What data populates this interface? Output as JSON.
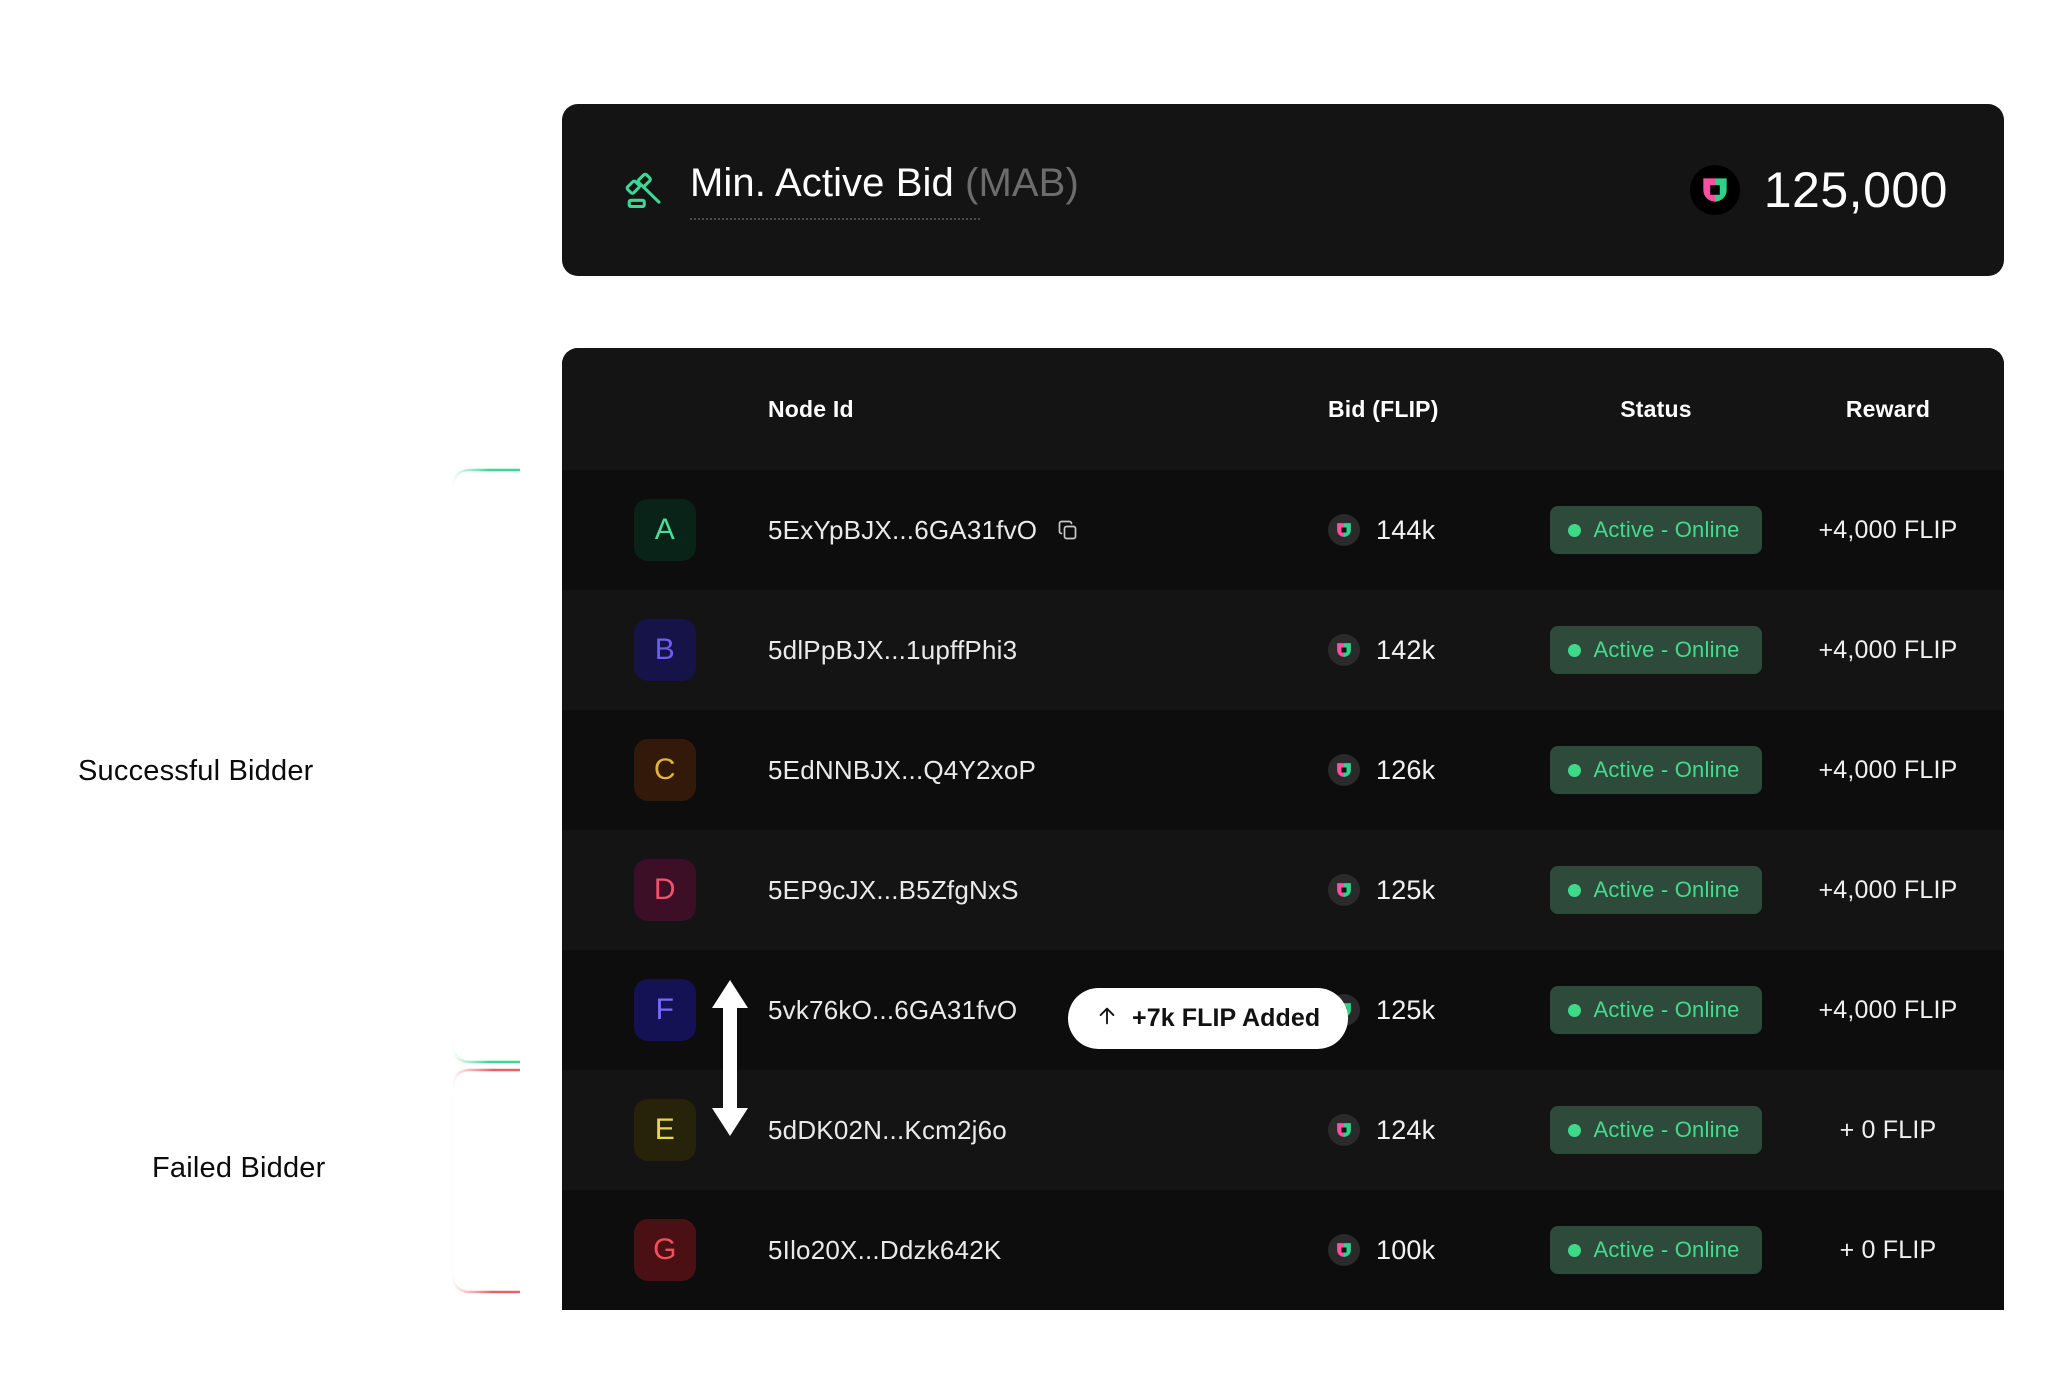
{
  "header_card": {
    "icon": "gavel-icon",
    "title_main": "Min. Active Bid",
    "title_abbr": "(MAB)",
    "token_icon": "flip-token-icon",
    "value": "125,000"
  },
  "table": {
    "columns": [
      "Node Id",
      "Bid (FLIP)",
      "Status",
      "Reward"
    ],
    "column_headers": {
      "node_id": "Node Id",
      "bid": "Bid (FLIP)",
      "status": "Status",
      "reward": "Reward"
    },
    "rows": [
      {
        "letter": "A",
        "avatar_bg": "#0a2318",
        "avatar_fg": "#4ade99",
        "node_id": "5ExYpBJX...6GA31fvO",
        "has_copy": true,
        "copy_icon": "copy-icon",
        "bid": "144k",
        "status": "Active - Online",
        "reward": "+4,000 FLIP"
      },
      {
        "letter": "B",
        "avatar_bg": "#151347",
        "avatar_fg": "#6d5bf5",
        "node_id": "5dlPpBJX...1upffPhi3",
        "has_copy": false,
        "bid": "142k",
        "status": "Active - Online",
        "reward": "+4,000 FLIP"
      },
      {
        "letter": "C",
        "avatar_bg": "#32190a",
        "avatar_fg": "#e0b43c",
        "node_id": "5EdNNBJX...Q4Y2xoP",
        "has_copy": false,
        "bid": "126k",
        "status": "Active - Online",
        "reward": "+4,000 FLIP"
      },
      {
        "letter": "D",
        "avatar_bg": "#3d0f27",
        "avatar_fg": "#f2506b",
        "node_id": "5EP9cJX...B5ZfgNxS",
        "has_copy": false,
        "bid": "125k",
        "status": "Active - Online",
        "reward": "+4,000 FLIP"
      },
      {
        "letter": "F",
        "avatar_bg": "#141154",
        "avatar_fg": "#7b68ff",
        "node_id": "5vk76kO...6GA31fvO",
        "has_copy": false,
        "bid": "125k",
        "status": "Active - Online",
        "reward": "+4,000 FLIP"
      },
      {
        "letter": "E",
        "avatar_bg": "#27220a",
        "avatar_fg": "#e8d84a",
        "node_id": "5dDK02N...Kcm2j6o",
        "has_copy": false,
        "bid": "124k",
        "status": "Active - Online",
        "reward": "+ 0 FLIP"
      },
      {
        "letter": "G",
        "avatar_bg": "#4a1013",
        "avatar_fg": "#f2505e",
        "node_id": "5Ilo20X...Ddzk642K",
        "has_copy": false,
        "bid": "100k",
        "status": "Active - Online",
        "reward": "+ 0 FLIP"
      }
    ]
  },
  "flip_added_pill": {
    "icon": "arrow-up-icon",
    "label": "+7k FLIP Added"
  },
  "bid_move_arrow": {
    "icon": "double-arrow-vertical-icon"
  },
  "annotations": {
    "successful": "Successful Bidder",
    "failed": "Failed Bidder"
  },
  "colors": {
    "accent_green": "#3fd98a",
    "bracket_green": "#3ed695",
    "bracket_red": "#e45a5f",
    "card_bg": "#141414",
    "panel_bg": "#0d0d0d",
    "page_bg": "#ffffff",
    "flip_pink": "#ff4fa3",
    "flip_green": "#46d98f"
  }
}
